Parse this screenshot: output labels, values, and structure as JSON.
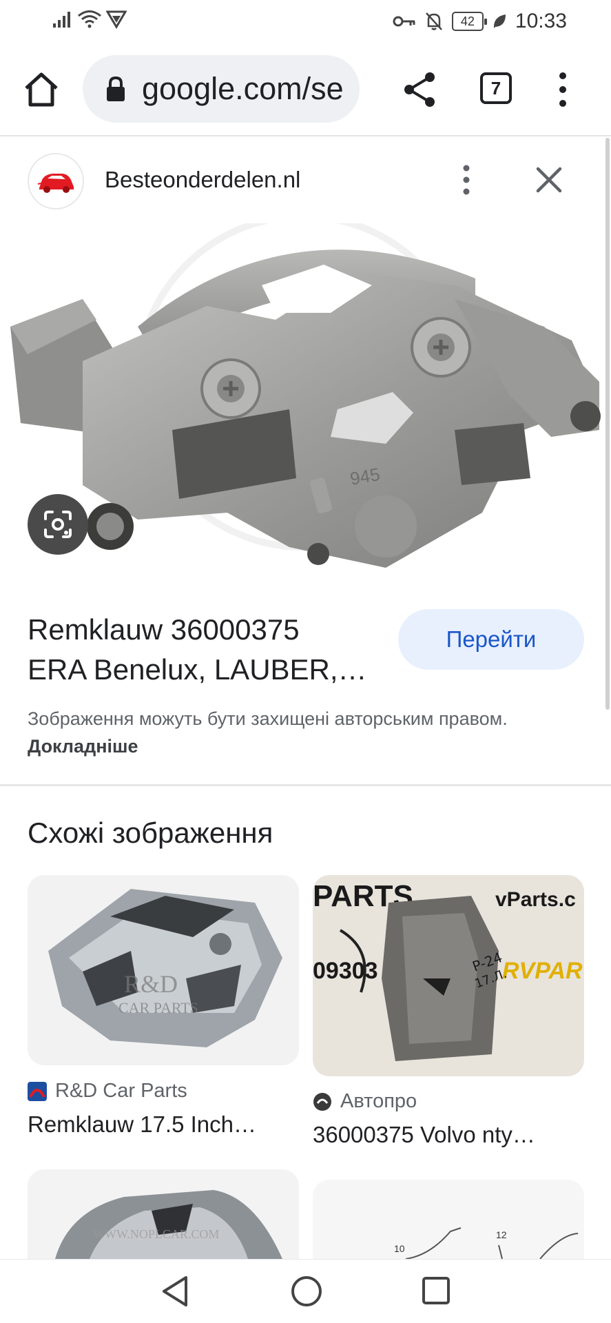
{
  "status_bar": {
    "time": "10:33",
    "battery": "42",
    "icons": [
      "signal-icon",
      "wifi-icon",
      "vpn-icon",
      "key-icon",
      "mute-icon",
      "battery-icon",
      "leaf-icon"
    ]
  },
  "browser": {
    "url": "google.com/se",
    "tab_count": "7",
    "icons": [
      "home-icon",
      "lock-icon",
      "share-icon",
      "tabs-icon",
      "more-vert-icon"
    ]
  },
  "viewer": {
    "site_name": "Besteonderdelen.nl",
    "result_title_line1": "Remklauw 36000375",
    "result_title_line2": "ERA Benelux, LAUBER,…",
    "go_button": "Перейти",
    "copyright_text": "Зображення можуть бути захищені авторським правом.",
    "copyright_link": "Докладніше",
    "icons": [
      "site-logo-icon",
      "more-vert-icon",
      "close-icon",
      "lens-icon"
    ]
  },
  "similar": {
    "heading": "Схожі зображення",
    "items": [
      {
        "source": "R&D Car Parts",
        "title": "Remklauw 17.5 Inch…",
        "watermark_line1": "R&D",
        "watermark_line2": "CAR PARTS"
      },
      {
        "source": "Автопро",
        "title": "36000375 Volvo nty…",
        "handwriting_line1": "P-24",
        "handwriting_line2": "17.Л.",
        "sign_left": "PARTS",
        "sign_right": "vParts.c",
        "sign_num": "09303",
        "sign_brand": "RVPAR"
      },
      {
        "source": "",
        "title": "",
        "watermark": "WWW.NOPLCAR.COM"
      },
      {
        "source": "",
        "title": "",
        "diagram_labels": [
          "10",
          "12"
        ]
      }
    ]
  },
  "navigation": {
    "icons": [
      "back-icon",
      "home-circle-icon",
      "recents-icon"
    ]
  }
}
